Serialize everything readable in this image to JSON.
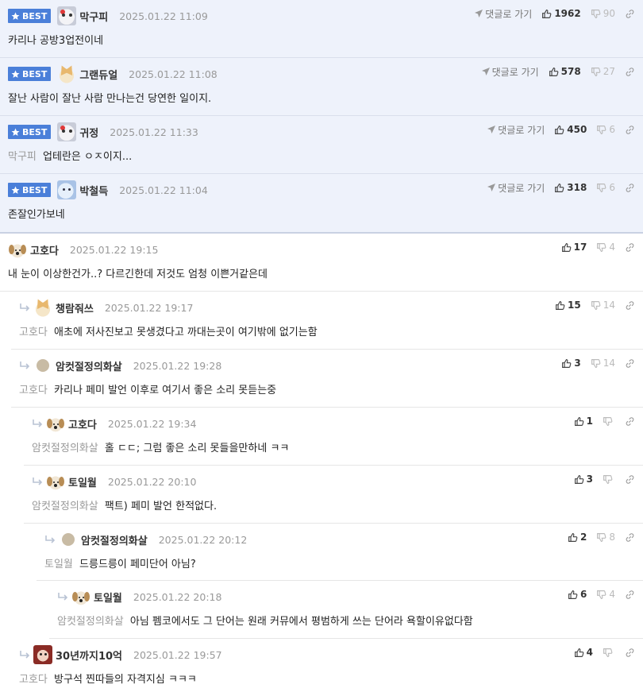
{
  "ui": {
    "best_badge": "BEST",
    "goto_label": "댓글로 가기"
  },
  "best_comments": [
    {
      "nick": "막구피",
      "date": "2025.01.22 11:09",
      "text": "카리나 공방3업전이네",
      "mention": "",
      "up": "1962",
      "down": "90",
      "avatar": "seal-icon"
    },
    {
      "nick": "그랜듀얼",
      "date": "2025.01.22 11:08",
      "text": "잘난 사람이 잘난 사람 만나는건 당연한 일이지.",
      "mention": "",
      "up": "578",
      "down": "27",
      "avatar": "cat-icon"
    },
    {
      "nick": "귀정",
      "date": "2025.01.22 11:33",
      "text": "업테란은 ㅇㅈ이지...",
      "mention": "막구피",
      "up": "450",
      "down": "6",
      "avatar": "seal-icon"
    },
    {
      "nick": "박철득",
      "date": "2025.01.22 11:04",
      "text": "존잘인가보네",
      "mention": "",
      "up": "318",
      "down": "6",
      "avatar": "ghost-icon"
    }
  ],
  "comments": [
    {
      "nick": "고호다",
      "date": "2025.01.22 19:15",
      "text": "내 눈이 이상한건가..? 다르긴한데 저것도 엄청 이쁜거같은데",
      "mention": "",
      "up": "17",
      "down": "4",
      "depth": 0,
      "avatar": "dog-icon"
    },
    {
      "nick": "챙람줘쓰",
      "date": "2025.01.22 19:17",
      "text": "애초에 저사진보고 못생겼다고 까대는곳이 여기밖에 없기는함",
      "mention": "고호다",
      "up": "15",
      "down": "14",
      "depth": 1,
      "avatar": "cat-icon"
    },
    {
      "nick": "암컷절정의화살",
      "date": "2025.01.22 19:28",
      "text": "카리나 페미 발언 이후로 여기서 좋은 소리 못듣는중",
      "mention": "고호다",
      "up": "3",
      "down": "14",
      "depth": 1,
      "avatar": "dot-icon"
    },
    {
      "nick": "고호다",
      "date": "2025.01.22 19:34",
      "text": "홀 ㄷㄷ; 그럼 좋은 소리 못들을만하네 ㅋㅋ",
      "mention": "암컷절정의화살",
      "up": "1",
      "down": "",
      "depth": 2,
      "avatar": "dog-icon"
    },
    {
      "nick": "토일월",
      "date": "2025.01.22 20:10",
      "text": "팩트) 페미 발언 한적없다.",
      "mention": "암컷절정의화살",
      "up": "3",
      "down": "",
      "depth": 2,
      "avatar": "dog-icon"
    },
    {
      "nick": "암컷절정의화살",
      "date": "2025.01.22 20:12",
      "text": "드릉드릉이 페미단어 아님?",
      "mention": "토일월",
      "up": "2",
      "down": "8",
      "depth": 3,
      "avatar": "dot-icon"
    },
    {
      "nick": "토일월",
      "date": "2025.01.22 20:18",
      "text": "아님 펨코에서도 그 단어는 원래 커뮤에서 평범하게 쓰는 단어라 욕할이유없다함",
      "mention": "암컷절정의화살",
      "up": "6",
      "down": "4",
      "depth": 4,
      "avatar": "dog-icon"
    },
    {
      "nick": "30년까지10억",
      "date": "2025.01.22 19:57",
      "text": "방구석 찐따들의 자격지심 ㅋㅋㅋ",
      "mention": "고호다",
      "up": "4",
      "down": "",
      "depth": 1,
      "avatar": "bear-icon"
    }
  ]
}
